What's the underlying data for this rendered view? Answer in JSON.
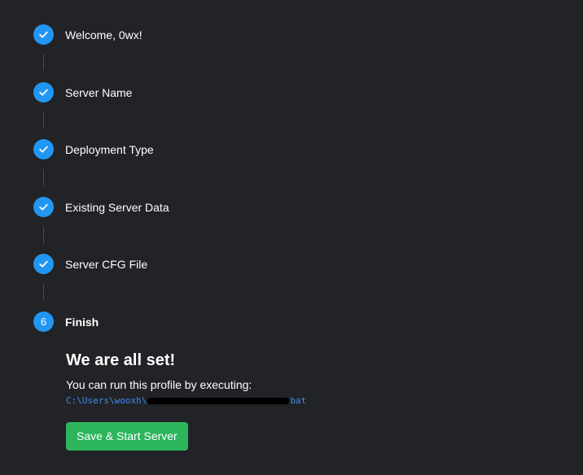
{
  "steps": [
    {
      "label": "Welcome, 0wx!",
      "status": "done",
      "icon": "check-icon"
    },
    {
      "label": "Server Name",
      "status": "done",
      "icon": "check-icon"
    },
    {
      "label": "Deployment Type",
      "status": "done",
      "icon": "check-icon"
    },
    {
      "label": "Existing Server Data",
      "status": "done",
      "icon": "check-icon"
    },
    {
      "label": "Server CFG File",
      "status": "done",
      "icon": "check-icon"
    },
    {
      "label": "Finish",
      "status": "active",
      "number": "6"
    }
  ],
  "finish": {
    "heading": "We are all set!",
    "description": "You can run this profile by executing:",
    "path_prefix": "C:\\Users\\wooxh\\",
    "path_suffix": "bat",
    "save_button_label": "Save & Start Server"
  },
  "colors": {
    "background": "#222326",
    "step_accent": "#2196f3",
    "path_text": "#3b8ef5",
    "save_button": "#2db55d"
  }
}
